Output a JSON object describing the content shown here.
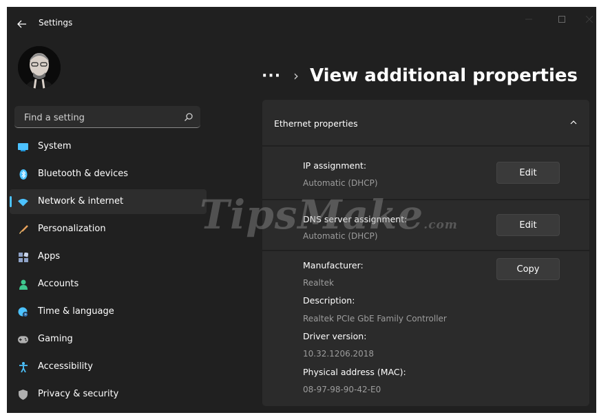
{
  "window": {
    "title": "Settings"
  },
  "search": {
    "placeholder": "Find a setting"
  },
  "sidebar": {
    "items": [
      {
        "label": "System",
        "icon": "monitor-icon",
        "color": "#4cc2ff"
      },
      {
        "label": "Bluetooth & devices",
        "icon": "bluetooth-icon",
        "color": "#4cc2ff"
      },
      {
        "label": "Network & internet",
        "icon": "wifi-icon",
        "color": "#4cc2ff",
        "active": true
      },
      {
        "label": "Personalization",
        "icon": "brush-icon",
        "color": "#e8a25c"
      },
      {
        "label": "Apps",
        "icon": "apps-icon",
        "color": "#8fa3c8"
      },
      {
        "label": "Accounts",
        "icon": "person-icon",
        "color": "#3fc88f"
      },
      {
        "label": "Time & language",
        "icon": "globe-clock-icon",
        "color": "#4cc2ff"
      },
      {
        "label": "Gaming",
        "icon": "gamepad-icon",
        "color": "#b0b0b0"
      },
      {
        "label": "Accessibility",
        "icon": "accessibility-icon",
        "color": "#4cc2ff"
      },
      {
        "label": "Privacy & security",
        "icon": "shield-icon",
        "color": "#b0b0b0"
      }
    ]
  },
  "header": {
    "more": "···",
    "separator": "›",
    "title": "View additional properties"
  },
  "card": {
    "title": "Ethernet properties",
    "ip": {
      "label": "IP assignment:",
      "value": "Automatic (DHCP)",
      "button": "Edit"
    },
    "dns": {
      "label": "DNS server assignment:",
      "value": "Automatic (DHCP)",
      "button": "Edit"
    },
    "details": {
      "button": "Copy",
      "manufacturer_label": "Manufacturer:",
      "manufacturer_value": "Realtek",
      "description_label": "Description:",
      "description_value": "Realtek PCIe GbE Family Controller",
      "driver_label": "Driver version:",
      "driver_value": "10.32.1206.2018",
      "mac_label": "Physical address (MAC):",
      "mac_value": "08-97-98-90-42-E0"
    }
  },
  "watermark": {
    "text": "TipsMake",
    "suffix": ".com"
  },
  "colors": {
    "accent": "#4cc2ff",
    "background": "#202020",
    "card": "#2b2b2b"
  }
}
